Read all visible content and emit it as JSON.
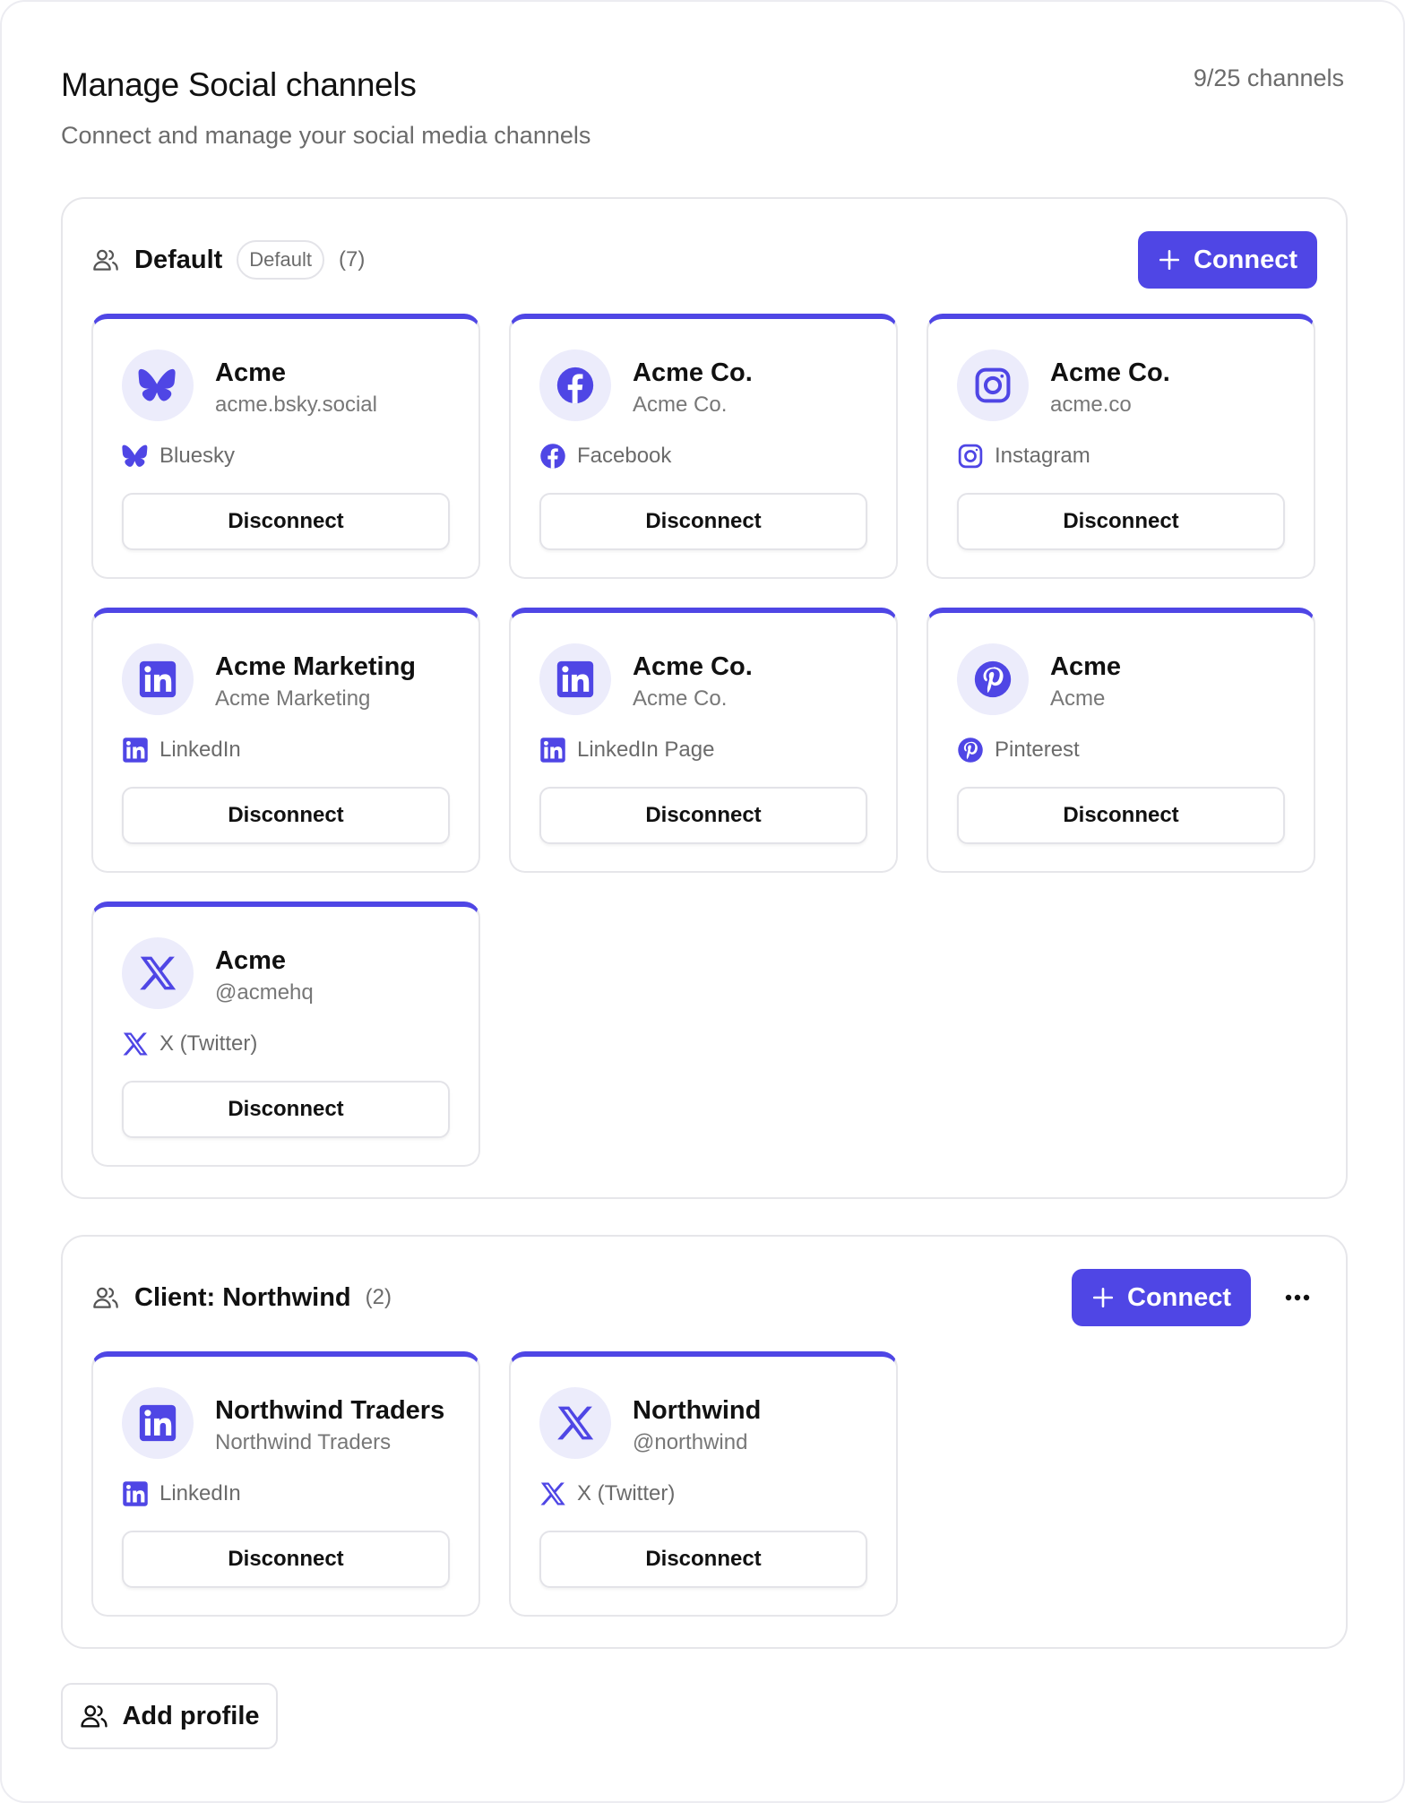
{
  "header": {
    "title": "Manage Social channels",
    "subtitle": "Connect and manage your social media channels",
    "channel_count": "9/25 channels"
  },
  "colors": {
    "accent": "#4f46e5",
    "avatar_bg": "#ececfb"
  },
  "profiles": [
    {
      "title": "Default",
      "badge": "Default",
      "count": "(7)",
      "connect_label": "Connect",
      "channels": [
        {
          "name": "Acme",
          "handle": "acme.bsky.social",
          "platform": "Bluesky",
          "icon": "bluesky-icon",
          "action": "Disconnect"
        },
        {
          "name": "Acme Co.",
          "handle": "Acme Co.",
          "platform": "Facebook",
          "icon": "facebook-icon",
          "action": "Disconnect"
        },
        {
          "name": "Acme Co.",
          "handle": "acme.co",
          "platform": "Instagram",
          "icon": "instagram-icon",
          "action": "Disconnect"
        },
        {
          "name": "Acme Marketing",
          "handle": "Acme Marketing",
          "platform": "LinkedIn",
          "icon": "linkedin-icon",
          "action": "Disconnect"
        },
        {
          "name": "Acme Co.",
          "handle": "Acme Co.",
          "platform": "LinkedIn Page",
          "icon": "linkedin-icon",
          "action": "Disconnect"
        },
        {
          "name": "Acme",
          "handle": "Acme",
          "platform": "Pinterest",
          "icon": "pinterest-icon",
          "action": "Disconnect"
        },
        {
          "name": "Acme",
          "handle": "@acmehq",
          "platform": "X (Twitter)",
          "icon": "x-icon",
          "action": "Disconnect"
        }
      ]
    },
    {
      "title": "Client: Northwind",
      "badge": "",
      "count": "(2)",
      "connect_label": "Connect",
      "channels": [
        {
          "name": "Northwind Traders",
          "handle": "Northwind Traders",
          "platform": "LinkedIn",
          "icon": "linkedin-icon",
          "action": "Disconnect"
        },
        {
          "name": "Northwind",
          "handle": "@northwind",
          "platform": "X (Twitter)",
          "icon": "x-icon",
          "action": "Disconnect"
        }
      ]
    }
  ],
  "add_profile_label": "Add profile"
}
